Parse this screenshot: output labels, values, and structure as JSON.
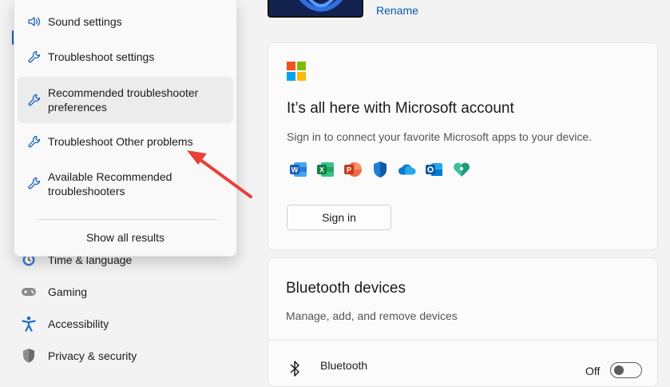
{
  "dropdown": {
    "items": [
      {
        "label": "Sound settings",
        "icon": "speaker-icon"
      },
      {
        "label": "Troubleshoot settings",
        "icon": "wrench-icon"
      },
      {
        "label": "Recommended troubleshooter preferences",
        "icon": "wrench-icon",
        "highlighted": true
      },
      {
        "label": "Troubleshoot Other problems",
        "icon": "wrench-icon"
      },
      {
        "label": "Available Recommended troubleshooters",
        "icon": "wrench-icon"
      }
    ],
    "show_all_label": "Show all results"
  },
  "sidebar": {
    "items": [
      {
        "label": "Time & language",
        "icon": "clock-globe-icon"
      },
      {
        "label": "Gaming",
        "icon": "gamepad-icon"
      },
      {
        "label": "Accessibility",
        "icon": "accessibility-icon"
      },
      {
        "label": "Privacy & security",
        "icon": "shield-icon"
      }
    ]
  },
  "device": {
    "rename_label": "Rename"
  },
  "microsoft_card": {
    "title": "It’s all here with Microsoft account",
    "subtitle": "Sign in to connect your favorite Microsoft apps to your device.",
    "sign_in_label": "Sign in",
    "apps": [
      "word-icon",
      "excel-icon",
      "powerpoint-icon",
      "defender-icon",
      "onedrive-icon",
      "outlook-icon",
      "family-icon"
    ]
  },
  "bluetooth_card": {
    "title": "Bluetooth devices",
    "subtitle": "Manage, add, and remove devices",
    "row_title": "Bluetooth",
    "toggle_state": "Off"
  },
  "colors": {
    "accent": "#0a58b4",
    "annotation_arrow": "#e8403a"
  }
}
